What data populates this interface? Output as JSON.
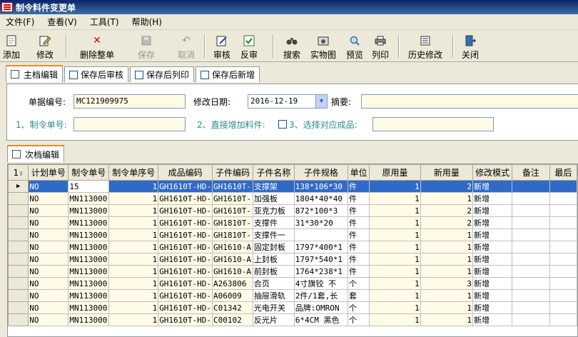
{
  "window": {
    "title": "制令料件变更单"
  },
  "menu": [
    "文件(F)",
    "查看(V)",
    "工具(T)",
    "帮助(H)"
  ],
  "toolbar": {
    "add": "添加",
    "edit": "修改",
    "delete_all": "删除整单",
    "save": "保存",
    "cancel": "取消",
    "audit": "审核",
    "unaudit": "反审",
    "search": "搜索",
    "photo": "实物图",
    "preview": "预览",
    "print": "列印",
    "history": "历史修改",
    "close": "关闭"
  },
  "top_tabs": {
    "main_edit": "主档编辑",
    "save_audit": "保存后审核",
    "save_print": "保存后列印",
    "save_new": "保存后新增"
  },
  "form": {
    "doc_no_label": "单据编号:",
    "doc_no": "MC121909975",
    "mod_date_label": "修改日期:",
    "mod_date": "2016-12-19",
    "summary_label": "摘要:",
    "summary": "",
    "order_no_label": "1、制令单号:",
    "order_no": "",
    "add_material_label": "2、直接增加料件:",
    "select_product_label": "3、选择对应成品:",
    "select_product": ""
  },
  "bottom_tabs": {
    "sub_edit": "次档编辑"
  },
  "grid": {
    "corner": "1",
    "columns": [
      "计划单号",
      "制令单号",
      "制令单序号",
      "成品编码",
      "子件编码",
      "子件名称",
      "子件规格",
      "单位",
      "原用量",
      "新用量",
      "修改模式",
      "备注",
      "最后"
    ],
    "rows": [
      [
        "NO",
        "15",
        "1",
        "GH1610T-HD-",
        "GH1610T-",
        "支撑架",
        "138*106*30",
        "件",
        "1",
        "2",
        "新增",
        "",
        ""
      ],
      [
        "NO",
        "MN113000",
        "1",
        "GH1610T-HD-",
        "GH1610T-",
        "加强板",
        "1804*40*40",
        "件",
        "1",
        "1",
        "新增",
        "",
        ""
      ],
      [
        "NO",
        "MN113000",
        "1",
        "GH1610T-HD-",
        "GH1610T-",
        "亚克力板",
        "872*100*3",
        "件",
        "1",
        "2",
        "新增",
        "",
        ""
      ],
      [
        "NO",
        "MN113000",
        "1",
        "GH1610T-HD-",
        "GH1810T-",
        "支撑件",
        "31*30*20",
        "件",
        "1",
        "2",
        "新增",
        "",
        ""
      ],
      [
        "NO",
        "MN113000",
        "1",
        "GH1610T-HD-",
        "GH1810T-",
        "支撑件一",
        "",
        "件",
        "1",
        "1",
        "新增",
        "",
        ""
      ],
      [
        "NO",
        "MN113000",
        "1",
        "GH1610T-HD-",
        "GH1610-A",
        "固定封板",
        "1797*400*1",
        "件",
        "1",
        "1",
        "新增",
        "",
        ""
      ],
      [
        "NO",
        "MN113000",
        "1",
        "GH1610T-HD-",
        "GH1610-A",
        "上封板",
        "1797*540*1",
        "件",
        "1",
        "1",
        "新增",
        "",
        ""
      ],
      [
        "NO",
        "MN113000",
        "1",
        "GH1610T-HD-",
        "GH1610-A",
        "前封板",
        "1764*238*1",
        "件",
        "1",
        "1",
        "新增",
        "",
        ""
      ],
      [
        "NO",
        "MN113000",
        "1",
        "GH1610T-HD-",
        "A263806",
        "合页",
        "4寸旗铰 不",
        "个",
        "1",
        "3",
        "新增",
        "",
        ""
      ],
      [
        "NO",
        "MN113000",
        "1",
        "GH1610T-HD-",
        "A06009",
        "抽屉滑轨",
        "2件/1套,长",
        "套",
        "1",
        "1",
        "新增",
        "",
        ""
      ],
      [
        "NO",
        "MN113000",
        "1",
        "GH1610T-HD-",
        "C01342",
        "光电开关",
        "品牌:OMRON",
        "个",
        "1",
        "1",
        "新增",
        "",
        ""
      ],
      [
        "NO",
        "MN113000",
        "1",
        "GH1610T-HD-",
        "C00102",
        "反光片",
        "6*4CM 黑色",
        "个",
        "1",
        "1",
        "新增",
        "",
        ""
      ]
    ]
  }
}
